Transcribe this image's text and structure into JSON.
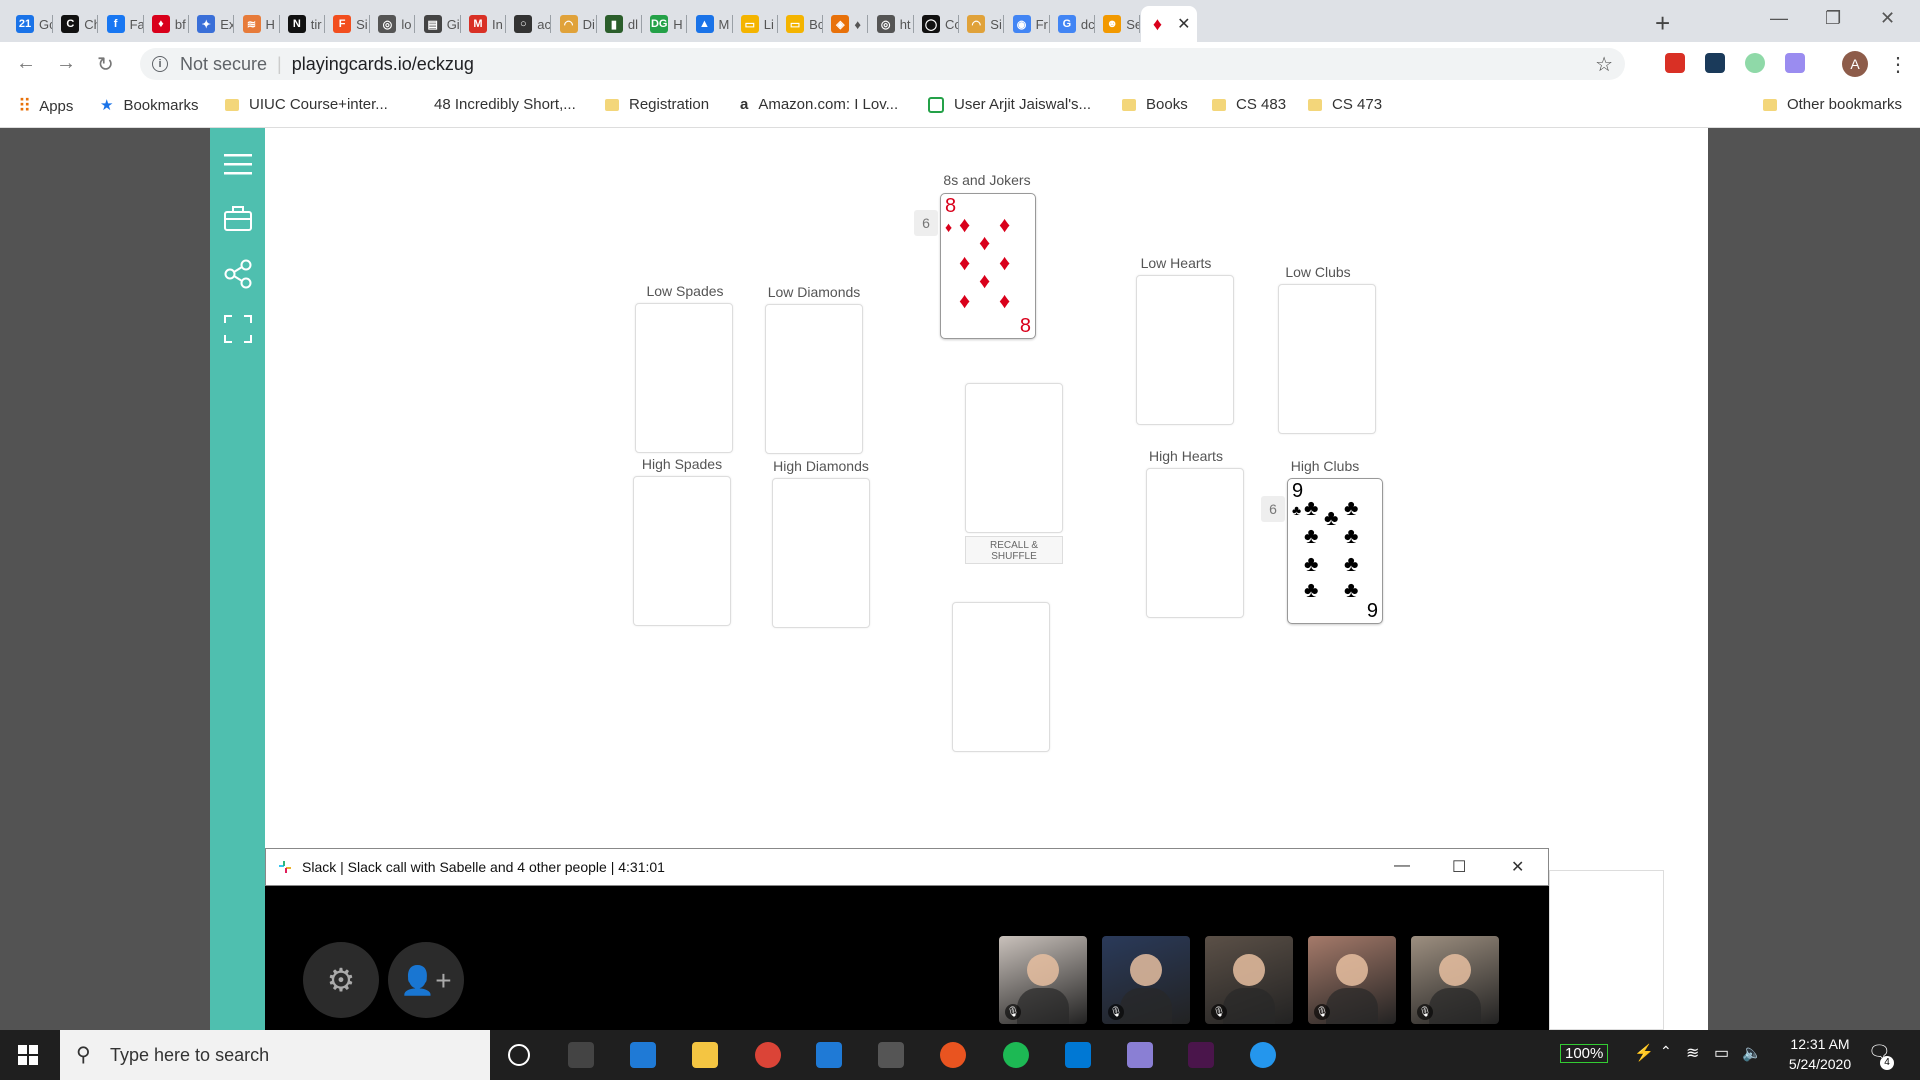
{
  "browser": {
    "tabs": [
      {
        "label": "Gc",
        "color": "#1a73e8",
        "glyph": "21"
      },
      {
        "label": "Ch",
        "color": "#111111",
        "glyph": "C"
      },
      {
        "label": "Fa",
        "color": "#1877f2",
        "glyph": "f"
      },
      {
        "label": "bf",
        "color": "#d9001b",
        "glyph": "♦"
      },
      {
        "label": "Ex",
        "color": "#3a6fd8",
        "glyph": "✦"
      },
      {
        "label": "H",
        "color": "#e77b3a",
        "glyph": "≋"
      },
      {
        "label": "tir",
        "color": "#111111",
        "glyph": "N"
      },
      {
        "label": "Si",
        "color": "#f24e1e",
        "glyph": "F"
      },
      {
        "label": "lo",
        "color": "#555555",
        "glyph": "◎"
      },
      {
        "label": "Gi",
        "color": "#444444",
        "glyph": "▤"
      },
      {
        "label": "In",
        "color": "#d93025",
        "glyph": "M"
      },
      {
        "label": "ac",
        "color": "#333333",
        "glyph": "○"
      },
      {
        "label": "Di",
        "color": "#e0a23a",
        "glyph": "◠"
      },
      {
        "label": "dl",
        "color": "#2b5e2b",
        "glyph": "▮"
      },
      {
        "label": "H",
        "color": "#24a148",
        "glyph": "DG"
      },
      {
        "label": "M",
        "color": "#1a73e8",
        "glyph": "▲"
      },
      {
        "label": "Li",
        "color": "#f4b400",
        "glyph": "▭"
      },
      {
        "label": "Bc",
        "color": "#f4b400",
        "glyph": "▭"
      },
      {
        "label": "♦",
        "color": "#e8710a",
        "glyph": "◈"
      },
      {
        "label": "ht",
        "color": "#555555",
        "glyph": "◎"
      },
      {
        "label": "Cc",
        "color": "#111111",
        "glyph": "◯"
      },
      {
        "label": "Si",
        "color": "#e0a23a",
        "glyph": "◠"
      },
      {
        "label": "Fr",
        "color": "#4285f4",
        "glyph": "◉"
      },
      {
        "label": "dc",
        "color": "#4285f4",
        "glyph": "G"
      },
      {
        "label": "Se",
        "color": "#f29900",
        "glyph": "☻"
      }
    ],
    "active_tab_glyph": "♦",
    "address": {
      "security": "Not secure",
      "url": "playingcards.io/eckzug"
    },
    "profile_initial": "A",
    "bookmarks": [
      {
        "label": "Apps",
        "type": "apps"
      },
      {
        "label": "Bookmarks",
        "type": "star"
      },
      {
        "label": "UIUC Course+inter...",
        "type": "folder"
      },
      {
        "label": "48 Incredibly Short,...",
        "type": "page"
      },
      {
        "label": "Registration",
        "type": "folder"
      },
      {
        "label": "Amazon.com: I Lov...",
        "type": "amazon"
      },
      {
        "label": "User Arjit Jaiswal's...",
        "type": "green"
      },
      {
        "label": "Books",
        "type": "folder"
      },
      {
        "label": "CS 483",
        "type": "folder"
      },
      {
        "label": "CS 473",
        "type": "folder"
      }
    ],
    "other_bookmarks": "Other bookmarks"
  },
  "game": {
    "piles": {
      "eights_jokers": {
        "label": "8s and Jokers",
        "count": "6",
        "card": {
          "rank": "8",
          "suit": "♦",
          "color": "#d9001b"
        }
      },
      "low_spades": {
        "label": "Low Spades"
      },
      "low_diamonds": {
        "label": "Low Diamonds"
      },
      "high_spades": {
        "label": "High Spades"
      },
      "high_diamonds": {
        "label": "High Diamonds"
      },
      "low_hearts": {
        "label": "Low Hearts"
      },
      "low_clubs": {
        "label": "Low Clubs"
      },
      "high_hearts": {
        "label": "High Hearts"
      },
      "high_clubs": {
        "label": "High Clubs",
        "count": "6",
        "card": {
          "rank": "9",
          "suit": "♣",
          "color": "#000000"
        }
      }
    },
    "recall_button": "RECALL & SHUFFLE"
  },
  "slack": {
    "title": "Slack | Slack call with Sabelle and 4 other people | 4:31:01",
    "participants": [
      {
        "bg": "#c9c1bb"
      },
      {
        "bg": "#2a3a5a"
      },
      {
        "bg": "#5b5047"
      },
      {
        "bg": "#a57a6a"
      },
      {
        "bg": "#9d8f80"
      }
    ]
  },
  "taskbar": {
    "search_placeholder": "Type here to search",
    "battery": "100%",
    "time": "12:31 AM",
    "date": "5/24/2020",
    "notifications": "4"
  }
}
